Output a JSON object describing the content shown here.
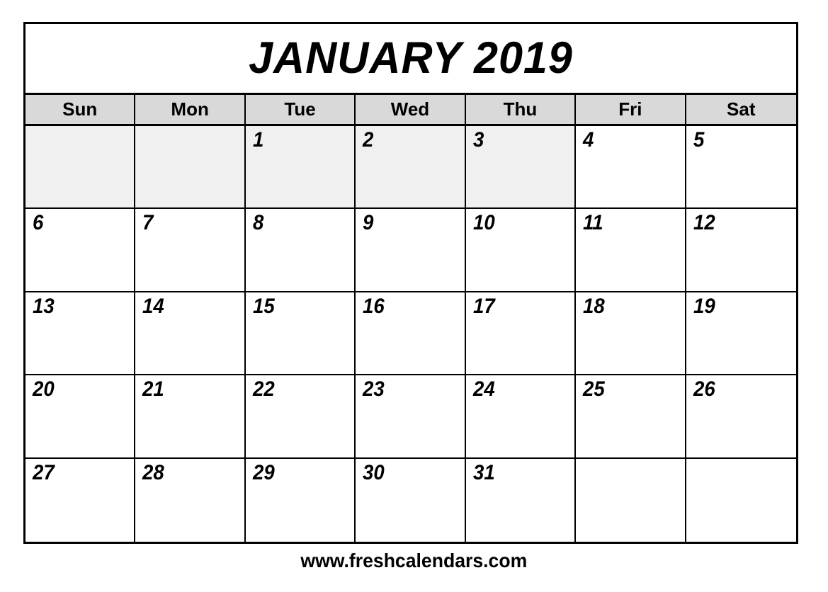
{
  "calendar": {
    "title": "JANUARY 2019",
    "month": "JANUARY",
    "year": "2019",
    "weekdays": [
      {
        "label": "Sun"
      },
      {
        "label": "Mon"
      },
      {
        "label": "Tue"
      },
      {
        "label": "Wed"
      },
      {
        "label": "Thu"
      },
      {
        "label": "Fri"
      },
      {
        "label": "Sat"
      }
    ],
    "weeks": [
      {
        "days": [
          {
            "number": "",
            "shaded": true
          },
          {
            "number": "",
            "shaded": true
          },
          {
            "number": "1",
            "shaded": true
          },
          {
            "number": "2",
            "shaded": true
          },
          {
            "number": "3",
            "shaded": true
          },
          {
            "number": "4",
            "shaded": false
          },
          {
            "number": "5",
            "shaded": false
          }
        ]
      },
      {
        "days": [
          {
            "number": "6",
            "shaded": false
          },
          {
            "number": "7",
            "shaded": false
          },
          {
            "number": "8",
            "shaded": false
          },
          {
            "number": "9",
            "shaded": false
          },
          {
            "number": "10",
            "shaded": false
          },
          {
            "number": "11",
            "shaded": false
          },
          {
            "number": "12",
            "shaded": false
          }
        ]
      },
      {
        "days": [
          {
            "number": "13",
            "shaded": false
          },
          {
            "number": "14",
            "shaded": false
          },
          {
            "number": "15",
            "shaded": false
          },
          {
            "number": "16",
            "shaded": false
          },
          {
            "number": "17",
            "shaded": false
          },
          {
            "number": "18",
            "shaded": false
          },
          {
            "number": "19",
            "shaded": false
          }
        ]
      },
      {
        "days": [
          {
            "number": "20",
            "shaded": false
          },
          {
            "number": "21",
            "shaded": false
          },
          {
            "number": "22",
            "shaded": false
          },
          {
            "number": "23",
            "shaded": false
          },
          {
            "number": "24",
            "shaded": false
          },
          {
            "number": "25",
            "shaded": false
          },
          {
            "number": "26",
            "shaded": false
          }
        ]
      },
      {
        "days": [
          {
            "number": "27",
            "shaded": false
          },
          {
            "number": "28",
            "shaded": false
          },
          {
            "number": "29",
            "shaded": false
          },
          {
            "number": "30",
            "shaded": false
          },
          {
            "number": "31",
            "shaded": false
          },
          {
            "number": "",
            "shaded": false
          },
          {
            "number": "",
            "shaded": false
          }
        ]
      }
    ]
  },
  "footer": {
    "website": "www.freshcalendars.com"
  },
  "colors": {
    "border": "#000000",
    "header_background": "#d9d9d9",
    "shaded_cell": "#f0f0f0",
    "cell_background": "#ffffff",
    "text": "#000000",
    "page_background": "#ffffff"
  }
}
